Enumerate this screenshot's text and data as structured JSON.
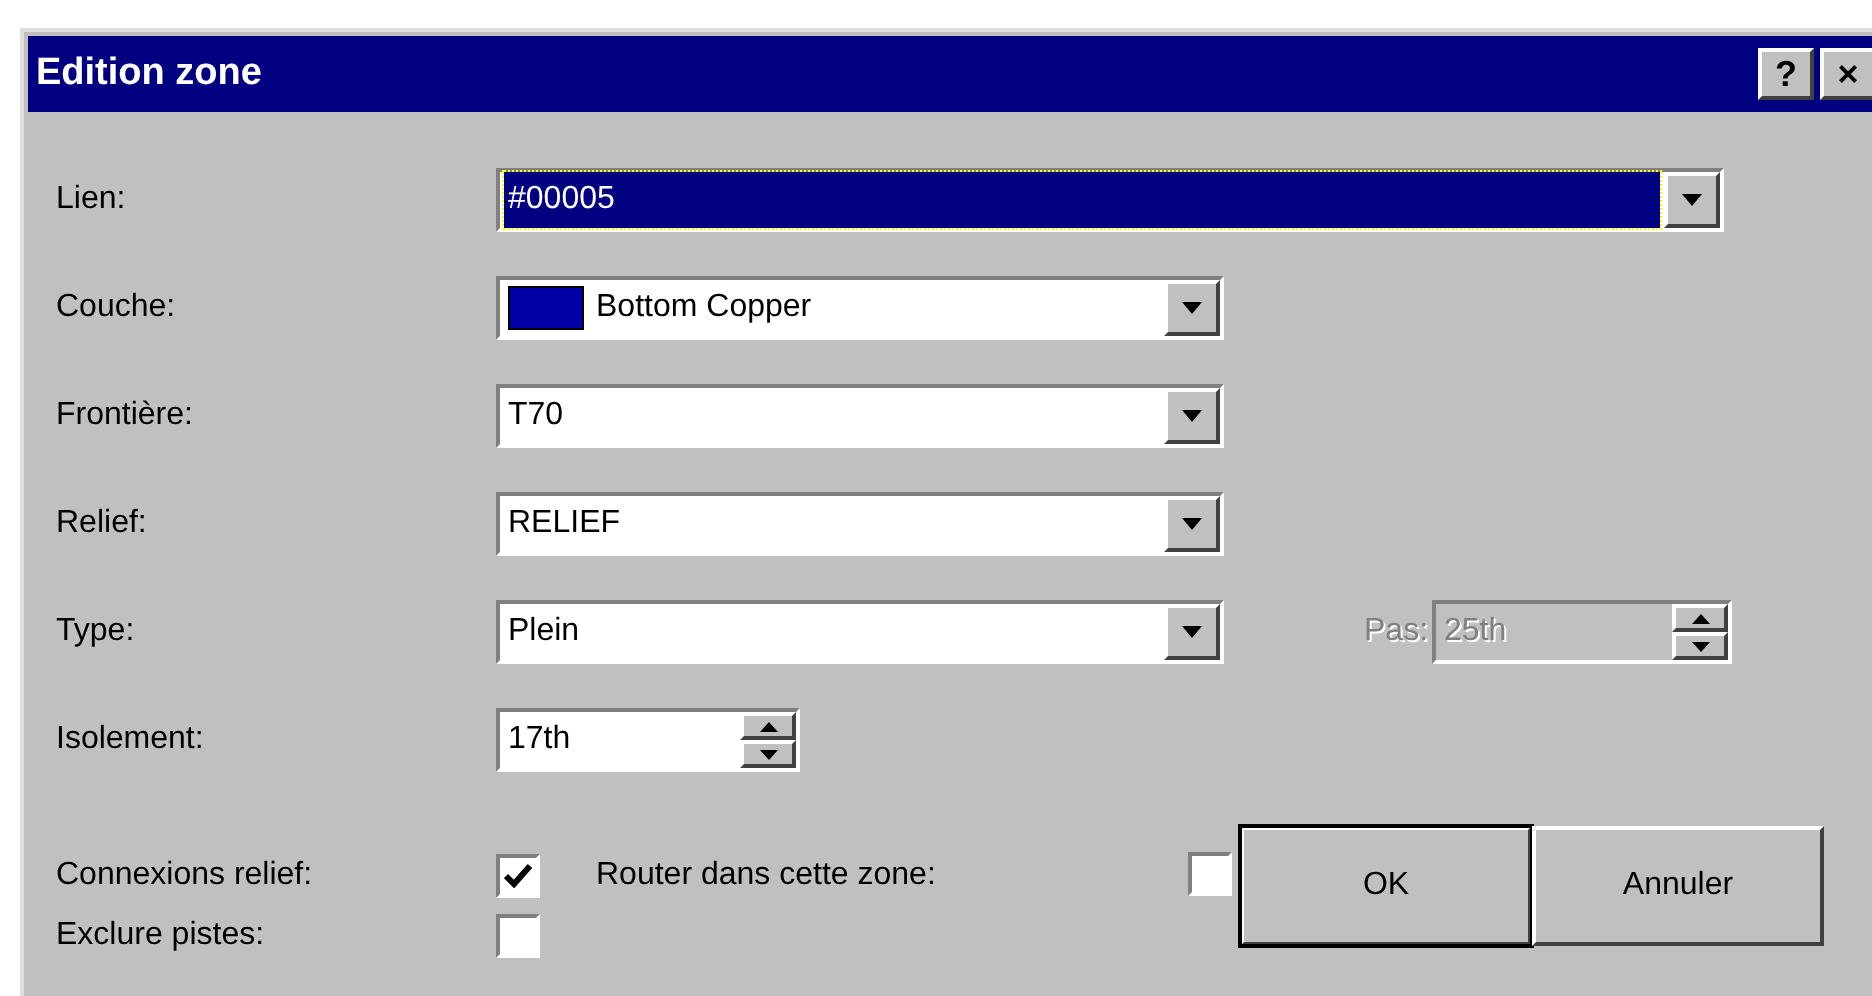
{
  "window": {
    "title": "Edition zone",
    "title_buttons": [
      "?",
      "×"
    ]
  },
  "fields": [
    {
      "kind": "wide_combo",
      "label": "Lien:",
      "value": "#00005",
      "focused": true
    },
    {
      "kind": "combo",
      "label": "Couche:",
      "value": "Bottom Copper",
      "focused": false,
      "color": "#0000a8"
    },
    {
      "kind": "combo",
      "label": "Frontière:",
      "value": "T70",
      "focused": false
    },
    {
      "kind": "combo",
      "label": "Relief:",
      "value": "RELIEF",
      "focused": false
    },
    {
      "kind": "combo",
      "label": "Type:",
      "value": "Plein",
      "focused": false,
      "extra": {
        "label": "Pas:",
        "value": "25th",
        "disabled": true
      }
    },
    {
      "kind": "spin",
      "label": "Isolement:",
      "value": "17th",
      "focused": false
    }
  ],
  "checkboxes": [
    {
      "label": "Connexions relief:",
      "checked": true
    },
    {
      "label": "Router dans cette zone:",
      "checked": false
    },
    {
      "label": "Exclure pistes:",
      "checked": false
    }
  ],
  "buttons": [
    {
      "label": "OK",
      "default": true
    },
    {
      "label": "Annuler",
      "default": false
    }
  ]
}
